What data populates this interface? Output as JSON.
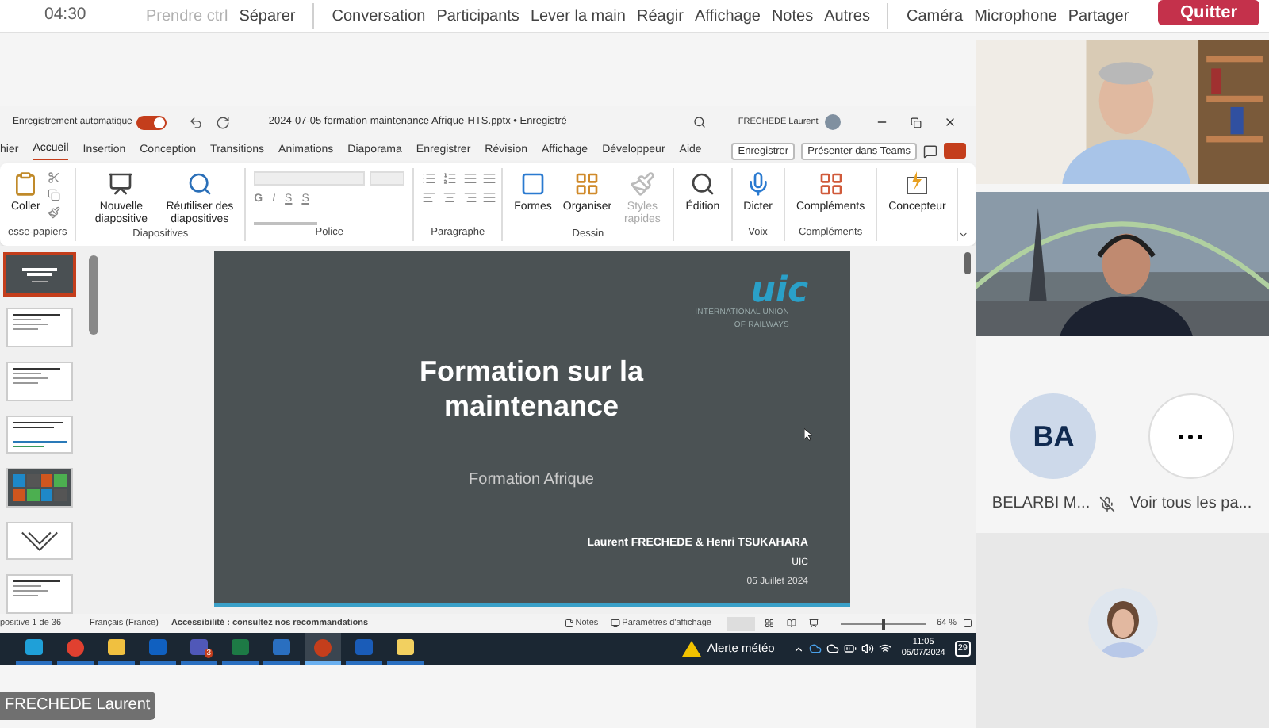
{
  "meeting_bar": {
    "time": "04:30",
    "items": [
      {
        "label": "Prendre ctrl",
        "disabled": true
      },
      {
        "label": "Séparer",
        "disabled": false
      },
      {
        "label": "Conversation",
        "disabled": false,
        "group_start": true
      },
      {
        "label": "Participants",
        "disabled": false
      },
      {
        "label": "Lever la main",
        "disabled": false
      },
      {
        "label": "Réagir",
        "disabled": false
      },
      {
        "label": "Affichage",
        "disabled": false
      },
      {
        "label": "Notes",
        "disabled": false
      },
      {
        "label": "Autres",
        "disabled": false
      },
      {
        "label": "Caméra",
        "disabled": false,
        "group_start": true
      },
      {
        "label": "Microphone",
        "disabled": false
      },
      {
        "label": "Partager",
        "disabled": false
      }
    ],
    "leave_button": "Quitter"
  },
  "shared_screen": {
    "title_bar": {
      "autosave_label": "Enregistrement automatique",
      "autosave_on": true,
      "file_title": "2024-07-05 formation maintenance Afrique-HTS.pptx • Enregistré",
      "user": "FRECHEDE Laurent"
    },
    "tabs": [
      {
        "label": "hier",
        "selected": false
      },
      {
        "label": "Accueil",
        "selected": true
      },
      {
        "label": "Insertion",
        "selected": false
      },
      {
        "label": "Conception",
        "selected": false
      },
      {
        "label": "Transitions",
        "selected": false
      },
      {
        "label": "Animations",
        "selected": false
      },
      {
        "label": "Diaporama",
        "selected": false
      },
      {
        "label": "Enregistrer",
        "selected": false
      },
      {
        "label": "Révision",
        "selected": false
      },
      {
        "label": "Affichage",
        "selected": false
      },
      {
        "label": "Développeur",
        "selected": false
      },
      {
        "label": "Aide",
        "selected": false
      }
    ],
    "tab_actions": [
      "Enregistrer",
      "Présenter dans Teams"
    ],
    "ribbon": [
      {
        "kind": "clipboard",
        "label": "esse-papiers",
        "buttons": [
          {
            "label": "Coller",
            "disabled": false
          }
        ]
      },
      {
        "kind": "slides",
        "label": "Diapositives",
        "buttons": [
          {
            "label": "Nouvelle diapositive",
            "disabled": false
          },
          {
            "label": "Réutiliser des diapositives",
            "disabled": false
          }
        ]
      },
      {
        "kind": "font",
        "label": "Police",
        "letters": [
          "G",
          "I",
          "S",
          "S"
        ]
      },
      {
        "kind": "paragraph",
        "label": "Paragraphe"
      },
      {
        "kind": "drawing",
        "label": "Dessin",
        "buttons": [
          {
            "label": "Formes",
            "disabled": false
          },
          {
            "label": "Organiser",
            "disabled": false
          },
          {
            "label": "Styles rapides",
            "disabled": true
          }
        ]
      },
      {
        "kind": "editing",
        "buttons": [
          {
            "label": "Édition",
            "disabled": false
          }
        ]
      },
      {
        "kind": "voice",
        "label": "Voix",
        "buttons": [
          {
            "label": "Dicter",
            "disabled": false
          }
        ]
      },
      {
        "kind": "addins",
        "label": "Compléments",
        "buttons": [
          {
            "label": "Compléments",
            "disabled": false
          }
        ]
      },
      {
        "kind": "designer",
        "buttons": [
          {
            "label": "Concepteur",
            "disabled": false
          }
        ]
      }
    ],
    "thumbnails": [
      {
        "kind": "title",
        "selected": true
      },
      {
        "kind": "text",
        "selected": false
      },
      {
        "kind": "text",
        "selected": false
      },
      {
        "kind": "timeline",
        "selected": false
      },
      {
        "kind": "grid",
        "selected": false
      },
      {
        "kind": "diagram",
        "selected": false
      },
      {
        "kind": "text",
        "selected": false
      }
    ],
    "slide": {
      "logo": "uic",
      "logo_caption": [
        "INTERNATIONAL UNION",
        "OF RAILWAYS"
      ],
      "title": "Formation sur la maintenance",
      "subtitle": "Formation Afrique",
      "authors": "Laurent FRECHEDE & Henri TSUKAHARA",
      "organization": "UIC",
      "date": "05 Juillet 2024"
    },
    "status_bar": {
      "slide_count": "positive 1 de 36",
      "language": "Français (France)",
      "accessibility": "Accessibilité : consultez nos recommandations",
      "notes": "Notes",
      "display_settings": "Paramètres d'affichage",
      "zoom": {
        "level": 0.5,
        "reading": "64 %"
      }
    },
    "taskbar": {
      "apps": [
        {
          "kind": "edge",
          "active": false
        },
        {
          "kind": "chrome",
          "active": false
        },
        {
          "kind": "folder",
          "active": false
        },
        {
          "kind": "outlook",
          "active": false
        },
        {
          "kind": "teams",
          "active": false,
          "badge": "3"
        },
        {
          "kind": "excel",
          "active": false
        },
        {
          "kind": "defender",
          "active": false
        },
        {
          "kind": "powerpoint",
          "active": true
        },
        {
          "kind": "word",
          "active": false
        },
        {
          "kind": "notes",
          "active": false
        }
      ],
      "weather": "Alerte météo",
      "time": "11:05",
      "date": "05/07/2024",
      "notifications": "29"
    }
  },
  "presenter_label": "FRECHEDE Laurent",
  "participants": {
    "videos": [
      {
        "kind": "office"
      },
      {
        "kind": "paris"
      }
    ],
    "tiles": [
      {
        "kind": "initials",
        "initials": "BA",
        "name": "BELARBI M...",
        "muted": true
      },
      {
        "kind": "more",
        "name": "Voir tous les pa..."
      }
    ]
  }
}
